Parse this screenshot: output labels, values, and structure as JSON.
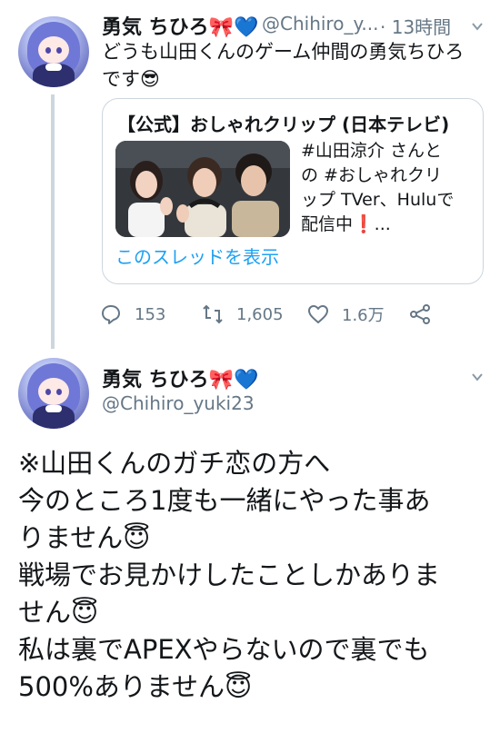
{
  "tweet1": {
    "display_name": "勇気 ちひろ🎀💙",
    "handle": "@Chihiro_y...",
    "time": "· 13時間",
    "text_line1": "どうも山田くんのゲーム仲間の勇気ちひろ",
    "text_line2": "です😎",
    "quote": {
      "name": "【公式】おしゃれクリップ (日本テレビ)",
      "text_line1": "#山田涼介 さんと",
      "text_line2": "の #おしゃれクリ",
      "text_line3": "ップ TVer、Huluで",
      "text_line4": "配信中❗...",
      "show_thread": "このスレッドを表示"
    },
    "actions": {
      "reply_count": "153",
      "retweet_count": "1,605",
      "like_count": "1.6万"
    }
  },
  "tweet2": {
    "display_name": "勇気 ちひろ🎀💙",
    "handle": "@Chihiro_yuki23",
    "lines": [
      "※山田くんのガチ恋の方へ",
      "今のところ1度も一緒にやった事あ",
      "りません😇",
      "戦場でお見かけしたことしかありま",
      "せん😇",
      "私は裏でAPEXやらないので裏でも",
      "500%ありません😇"
    ]
  },
  "colors": {
    "accent": "#1da1f2",
    "secondary_text": "#657786",
    "border": "#ccd6dd"
  },
  "icons": {
    "reply": "reply-icon",
    "retweet": "retweet-icon",
    "like": "heart-icon",
    "share": "share-icon",
    "caret": "chevron-down-icon"
  }
}
